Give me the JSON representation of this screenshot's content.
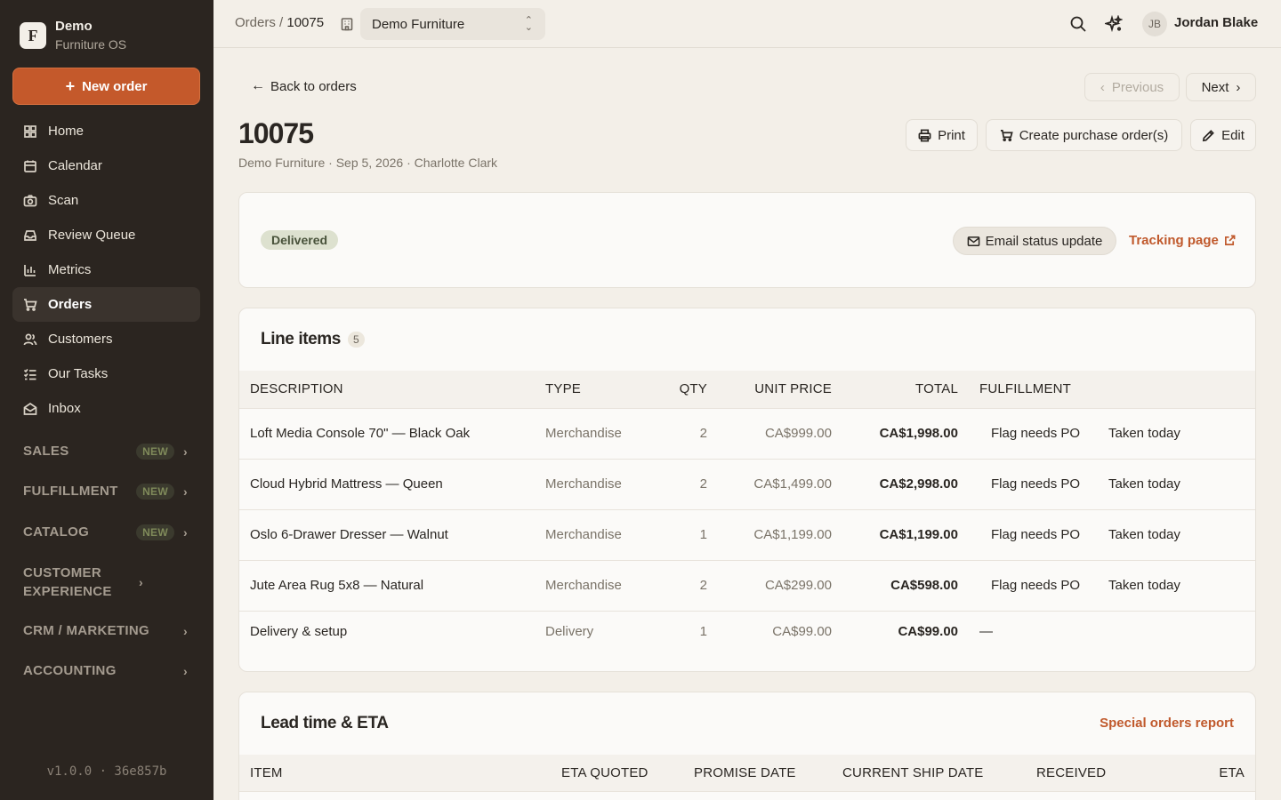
{
  "brand": {
    "logo_letter": "F",
    "name": "Demo",
    "sub": "Furniture OS"
  },
  "sidebar": {
    "new_order": "New order",
    "items": [
      {
        "label": "Home",
        "icon": "home-grid-icon"
      },
      {
        "label": "Calendar",
        "icon": "calendar-icon"
      },
      {
        "label": "Scan",
        "icon": "camera-icon"
      },
      {
        "label": "Review Queue",
        "icon": "inbox-tray-icon"
      },
      {
        "label": "Metrics",
        "icon": "bar-chart-icon"
      },
      {
        "label": "Orders",
        "icon": "cart-icon",
        "active": true
      },
      {
        "label": "Customers",
        "icon": "users-icon"
      },
      {
        "label": "Our Tasks",
        "icon": "list-checks-icon"
      },
      {
        "label": "Inbox",
        "icon": "envelope-open-icon"
      }
    ],
    "sections": [
      {
        "label": "SALES",
        "badge": "NEW"
      },
      {
        "label": "FULFILLMENT",
        "badge": "NEW"
      },
      {
        "label": "CATALOG",
        "badge": "NEW"
      },
      {
        "label": "CUSTOMER EXPERIENCE",
        "badge": ""
      },
      {
        "label": "CRM / MARKETING",
        "badge": ""
      },
      {
        "label": "ACCOUNTING",
        "badge": ""
      }
    ],
    "version": "v1.0.0 · 36e857b"
  },
  "topbar": {
    "crumb_parent": "Orders",
    "crumb_sep": "/",
    "crumb_current": "10075",
    "org": "Demo Furniture",
    "avatar_initials": "JB",
    "user_name": "Jordan Blake"
  },
  "order": {
    "back": "Back to orders",
    "previous": "Previous",
    "next": "Next",
    "number": "10075",
    "subtitle": "Demo Furniture · Sep 5, 2026 · Charlotte Clark",
    "print": "Print",
    "create_po": "Create purchase order(s)",
    "edit": "Edit"
  },
  "status": {
    "label": "Delivered",
    "email_btn": "Email status update",
    "tracking": "Tracking page"
  },
  "line_items": {
    "title": "Line items",
    "count": "5",
    "headers": [
      "DESCRIPTION",
      "TYPE",
      "QTY",
      "UNIT PRICE",
      "TOTAL",
      "FULFILLMENT"
    ],
    "rows": [
      {
        "desc": "Loft Media Console 70\" — Black Oak",
        "type": "Merchandise",
        "qty": "2",
        "unit": "CA$999.00",
        "total": "CA$1,998.00",
        "flag": "Flag needs PO",
        "fulfillment": "Taken today"
      },
      {
        "desc": "Cloud Hybrid Mattress — Queen",
        "type": "Merchandise",
        "qty": "2",
        "unit": "CA$1,499.00",
        "total": "CA$2,998.00",
        "flag": "Flag needs PO",
        "fulfillment": "Taken today"
      },
      {
        "desc": "Oslo 6-Drawer Dresser — Walnut",
        "type": "Merchandise",
        "qty": "1",
        "unit": "CA$1,199.00",
        "total": "CA$1,199.00",
        "flag": "Flag needs PO",
        "fulfillment": "Taken today"
      },
      {
        "desc": "Jute Area Rug 5x8 — Natural",
        "type": "Merchandise",
        "qty": "2",
        "unit": "CA$299.00",
        "total": "CA$598.00",
        "flag": "Flag needs PO",
        "fulfillment": "Taken today"
      },
      {
        "desc": "Delivery & setup",
        "type": "Delivery",
        "qty": "1",
        "unit": "CA$99.00",
        "total": "CA$99.00",
        "flag": "—",
        "fulfillment": ""
      }
    ]
  },
  "lead_time": {
    "title": "Lead time & ETA",
    "report_link": "Special orders report",
    "headers": [
      "ITEM",
      "ETA QUOTED",
      "PROMISE DATE",
      "CURRENT SHIP DATE",
      "RECEIVED",
      "ETA"
    ]
  },
  "colors": {
    "accent": "#c4592b",
    "sidebar_bg": "#2b2520",
    "page_bg": "#f3efe8",
    "status_bg": "#dde1cf"
  }
}
